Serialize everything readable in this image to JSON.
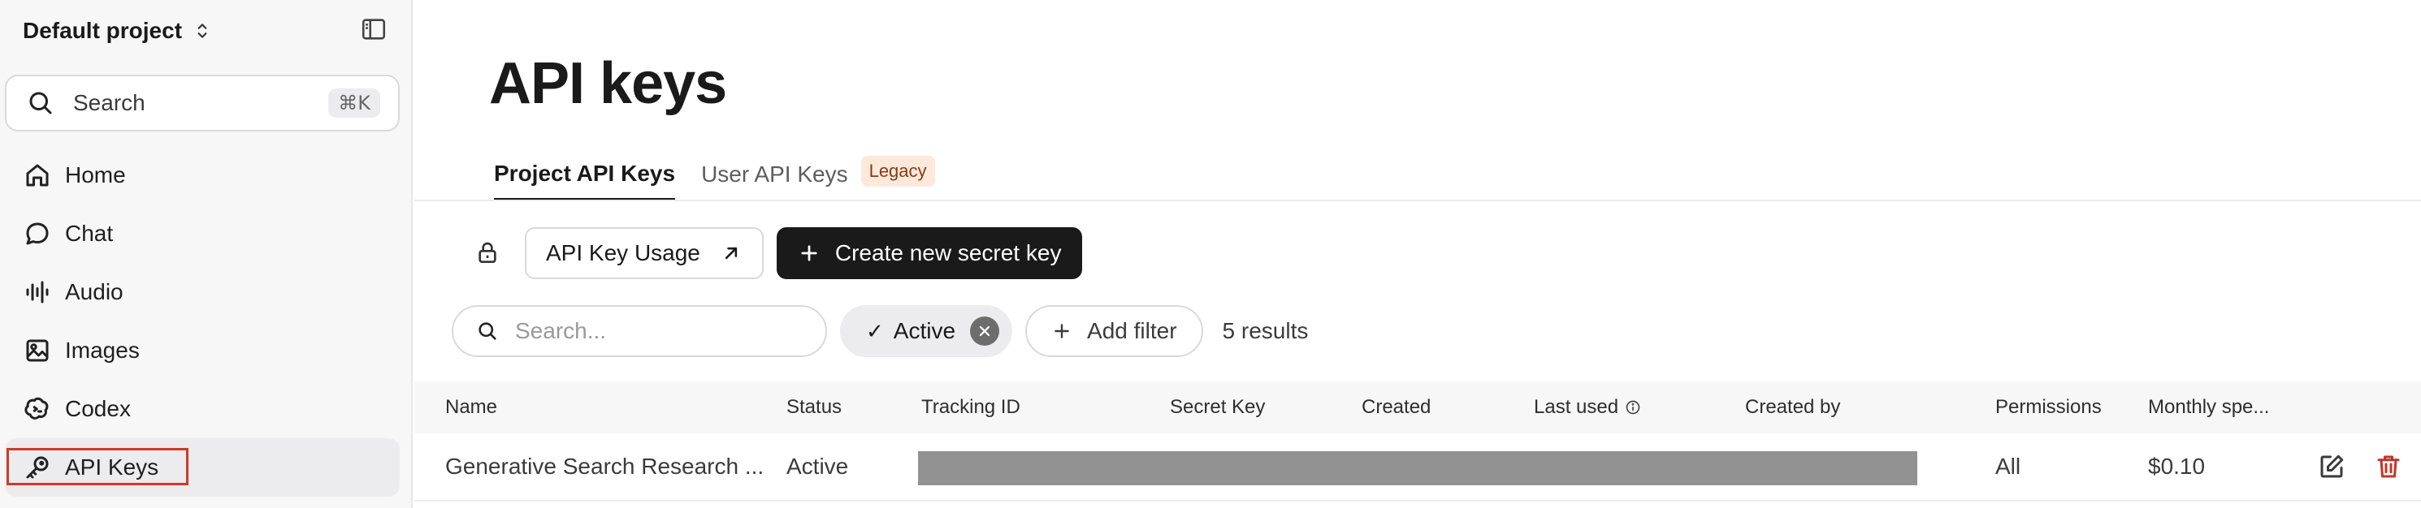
{
  "sidebar": {
    "project_name": "Default project",
    "search_label": "Search",
    "search_shortcut": "⌘K",
    "items": [
      {
        "label": "Home",
        "icon": "home-icon"
      },
      {
        "label": "Chat",
        "icon": "chat-bubble-icon"
      },
      {
        "label": "Audio",
        "icon": "audio-wave-icon"
      },
      {
        "label": "Images",
        "icon": "image-icon"
      },
      {
        "label": "Codex",
        "icon": "codex-icon"
      },
      {
        "label": "API Keys",
        "icon": "key-icon"
      }
    ],
    "active_item": "API Keys"
  },
  "page": {
    "title": "API keys",
    "tabs": [
      {
        "label": "Project API Keys",
        "active": true
      },
      {
        "label": "User API Keys",
        "badge": "Legacy",
        "active": false
      }
    ]
  },
  "toolbar": {
    "usage_button": "API Key Usage",
    "create_button": "Create new secret key"
  },
  "filters": {
    "search_placeholder": "Search...",
    "active_chip": "Active",
    "add_filter": "Add filter",
    "results": "5 results"
  },
  "table": {
    "columns": [
      "Name",
      "Status",
      "Tracking ID",
      "Secret Key",
      "Created",
      "Last used",
      "Created by",
      "Permissions",
      "Monthly spe..."
    ],
    "rows": [
      {
        "name": "Generative Search Research ...",
        "status": "Active",
        "permissions": "All",
        "monthly_spend": "$0.10"
      }
    ]
  },
  "colors": {
    "accent_dark": "#1a1a1a",
    "highlight_box": "#cf3a2a",
    "delete_icon": "#c0352b",
    "legacy_badge_bg": "#fde9dc"
  }
}
